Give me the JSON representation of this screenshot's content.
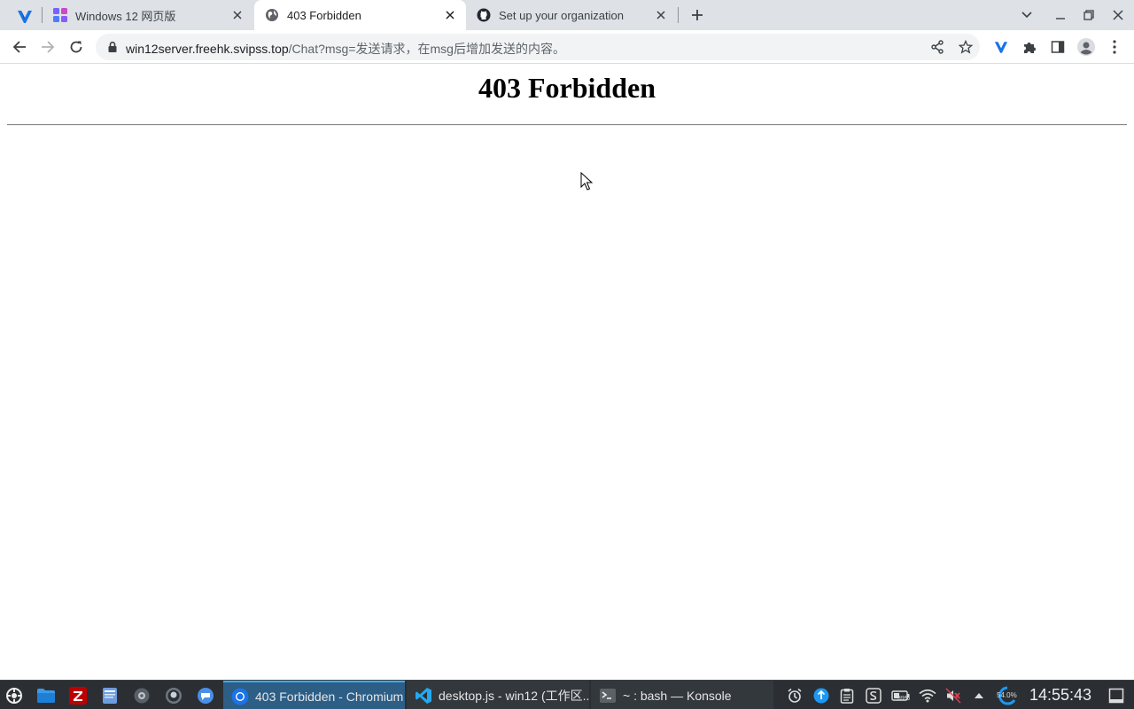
{
  "browser": {
    "tabs": [
      {
        "title": "Windows 12 网页版",
        "favicon": "windows12-icon",
        "active": false
      },
      {
        "title": "403 Forbidden",
        "favicon": "globe-icon",
        "active": true
      },
      {
        "title": "Set up your organization",
        "favicon": "github-icon",
        "active": false
      }
    ],
    "address": {
      "host": "win12server.freehk.svipss.top",
      "path": "/Chat?msg=发送请求，在msg后增加发送的内容。"
    }
  },
  "page": {
    "heading": "403 Forbidden"
  },
  "taskbar": {
    "tasks": [
      {
        "label": "403 Forbidden - Chromium",
        "icon": "chromium-icon",
        "active": true
      },
      {
        "label": "desktop.js - win12 (工作区...",
        "icon": "vscode-icon",
        "active": false
      },
      {
        "label": "~ : bash — Konsole",
        "icon": "konsole-icon",
        "active": false
      }
    ],
    "battery_percent": "39%",
    "cpu_percent": "54.0%",
    "clock": "14:55:43"
  },
  "colors": {
    "tabstrip": "#dee1e6",
    "taskbar": "#2b2f33",
    "active_task": "#2c5e86",
    "accent": "#3daee9"
  }
}
